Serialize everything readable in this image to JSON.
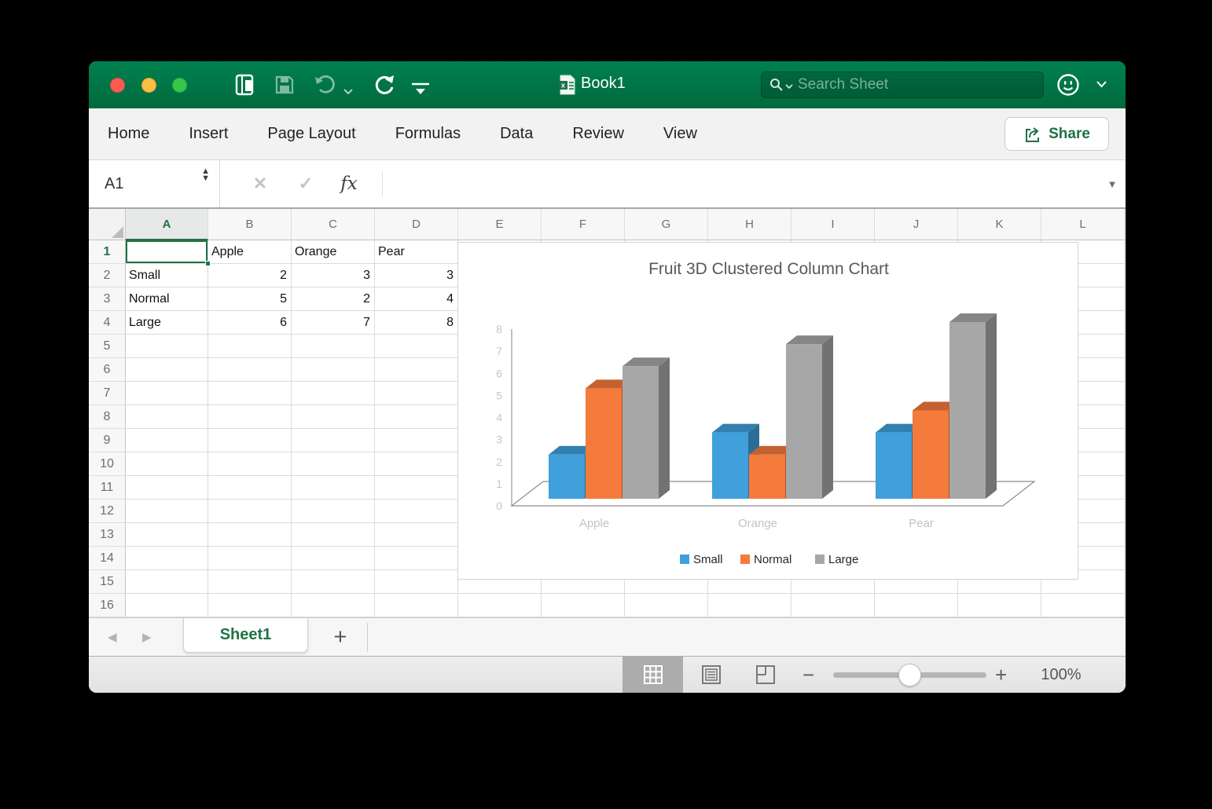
{
  "colors": {
    "titlebar_green": "#00784A",
    "accent_green": "#217346",
    "selection_green": "#1F7245",
    "traffic_red": "#FC5B52",
    "traffic_yellow": "#FDBE41",
    "traffic_green": "#34C749",
    "series_blue": "#3FA0DB",
    "series_orange": "#F47B3C",
    "series_gray": "#A7A7A7"
  },
  "titlebar": {
    "title": "Book1",
    "search_placeholder": "Search Sheet"
  },
  "ribbon": {
    "tabs": [
      "Home",
      "Insert",
      "Page Layout",
      "Formulas",
      "Data",
      "Review",
      "View"
    ],
    "share_label": "Share"
  },
  "formula_bar": {
    "cell_ref": "A1",
    "fx_label": "fx",
    "cancel_icon": "✕",
    "confirm_icon": "✓",
    "dropdown_icon": "▼",
    "stepper_up": "▲",
    "stepper_down": "▼"
  },
  "spreadsheet": {
    "visible_columns": [
      "A",
      "B",
      "C",
      "D",
      "E",
      "F",
      "G",
      "H",
      "I",
      "J",
      "K",
      "L"
    ],
    "visible_rows": 16,
    "selected_cell": "A1",
    "selected_column": "A",
    "selected_row": "1",
    "cells": {
      "B1": "Apple",
      "C1": "Orange",
      "D1": "Pear",
      "A2": "Small",
      "B2": "2",
      "C2": "3",
      "D2": "3",
      "A3": "Normal",
      "B3": "5",
      "C3": "2",
      "D3": "4",
      "A4": "Large",
      "B4": "6",
      "C4": "7",
      "D4": "8"
    }
  },
  "chart_data": {
    "type": "bar",
    "subtype": "3d-clustered-column",
    "title": "Fruit 3D Clustered Column Chart",
    "categories": [
      "Apple",
      "Orange",
      "Pear"
    ],
    "series": [
      {
        "name": "Small",
        "color": "#3FA0DB",
        "values": [
          2,
          3,
          3
        ]
      },
      {
        "name": "Normal",
        "color": "#F47B3C",
        "values": [
          5,
          2,
          4
        ]
      },
      {
        "name": "Large",
        "color": "#A7A7A7",
        "values": [
          6,
          7,
          8
        ]
      }
    ],
    "ylim": [
      0,
      8
    ],
    "yticks": [
      0,
      1,
      2,
      3,
      4,
      5,
      6,
      7,
      8
    ],
    "grid": false,
    "legend_position": "bottom"
  },
  "sheet_tabs": {
    "prev_icon": "◀",
    "next_icon": "▶",
    "active_tab": "Sheet1",
    "add_tab_label": "+"
  },
  "status_bar": {
    "zoom_out_icon": "−",
    "zoom_in_icon": "+",
    "zoom_label": "100%"
  }
}
